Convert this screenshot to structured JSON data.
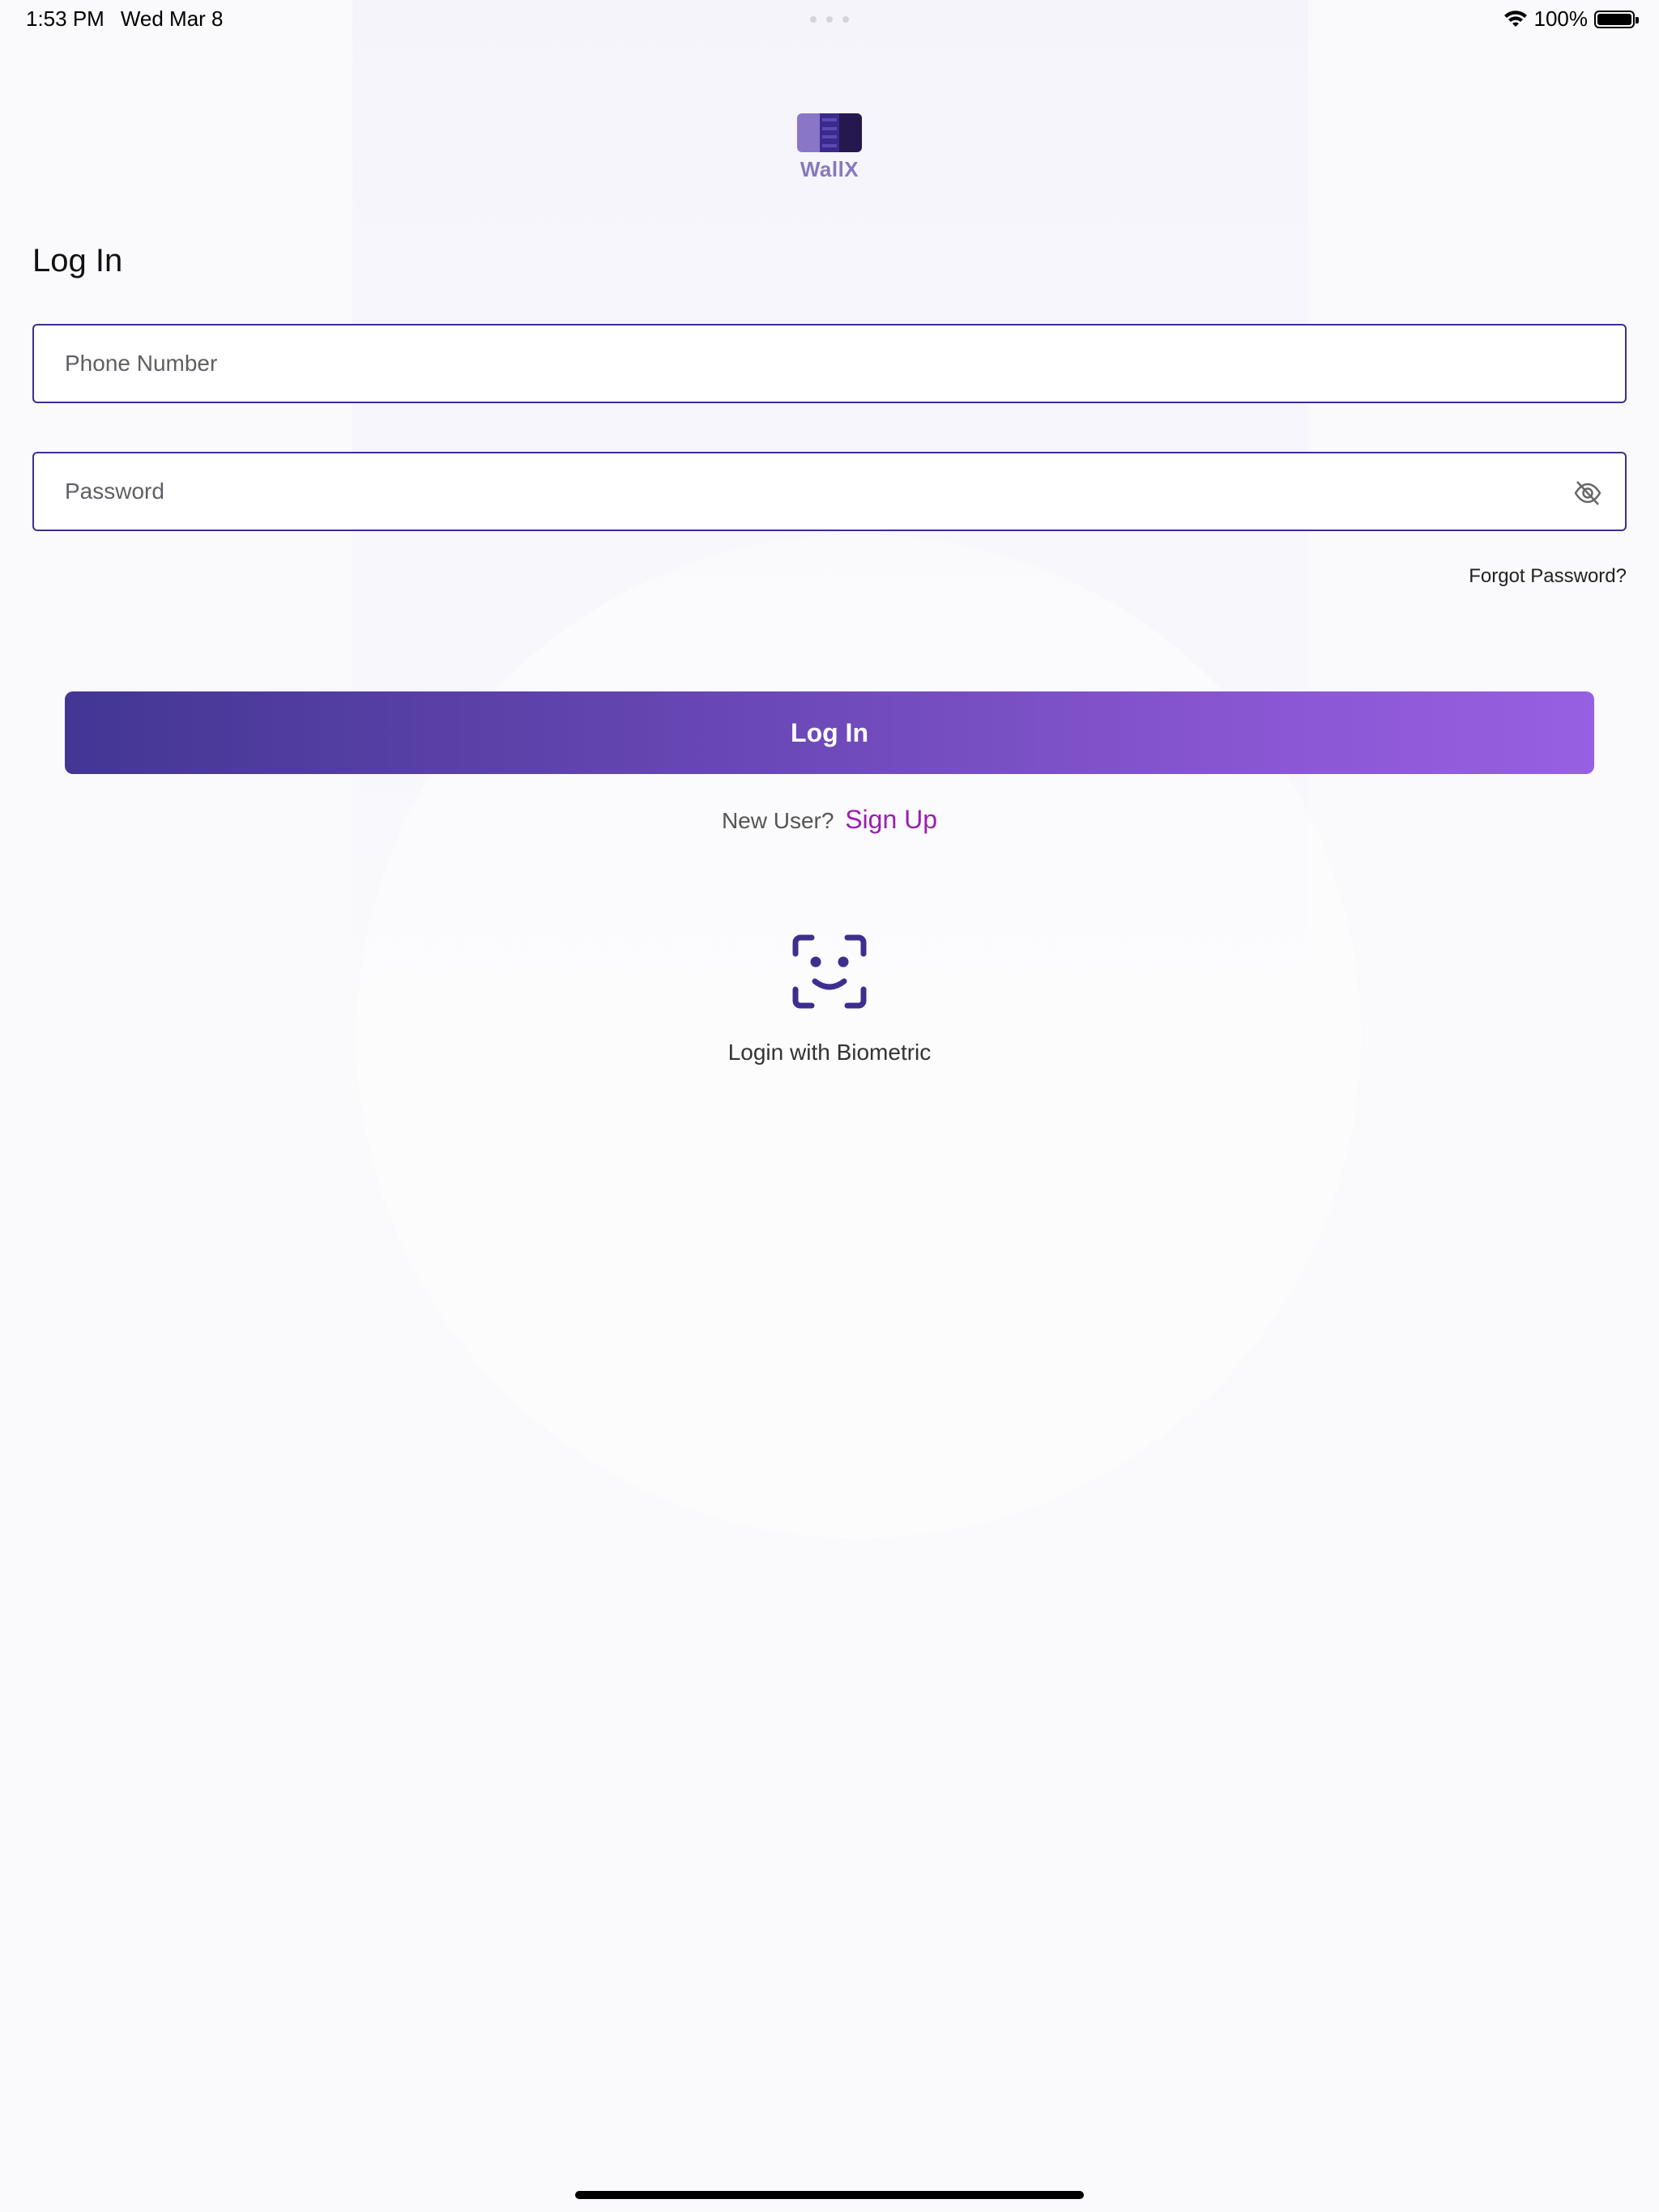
{
  "status_bar": {
    "time": "1:53 PM",
    "date": "Wed Mar 8",
    "battery": "100%"
  },
  "logo": {
    "text": "WallX"
  },
  "title": "Log In",
  "form": {
    "phone_placeholder": "Phone Number",
    "password_placeholder": "Password",
    "forgot_password": "Forgot Password?"
  },
  "login_button": "Log In",
  "signup": {
    "prompt": "New User?",
    "link": "Sign Up"
  },
  "biometric": {
    "label": "Login with Biometric"
  },
  "colors": {
    "accent": "#3d2f8f",
    "button_start": "#433693",
    "button_end": "#975fe2",
    "signup_link": "#9a1fb0"
  },
  "icons": [
    "wifi-icon",
    "battery-icon",
    "eye-slash-icon",
    "face-id-icon"
  ]
}
